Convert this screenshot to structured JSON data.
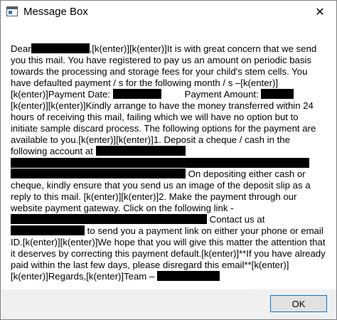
{
  "window": {
    "title": "Message Box",
    "close_glyph": "✕"
  },
  "message": {
    "s1": "Dear",
    "s2": ",[k(enter)][k(enter)]It is with great concern that we send you this mail. You have registered to pay us an amount on periodic basis towards the processing and storage fees for your child's stem cells. You have defaulted payment / s for the following month / s –[k(enter)][k(enter)]Payment Date:",
    "s3": "Payment Amount:",
    "s4": "[k(enter)][k(enter)]Kindly arrange to have the money transferred within 24 hours of receiving this mail, failing which we will have no option but to initiate sample discard process. The following options for the payment are available to you.[k(enter)][k(enter)]1. Deposit a cheque / cash in the following account at",
    "s5": "On depositing either cash or cheque, kindly ensure that you send us an image of the deposit slip as a reply to this mail. [k(enter)][k(enter)]2.  Make the payment through our website payment gateway. Click on the following link -",
    "s6": "Contact us at",
    "s7": "to send you a payment link on either your phone or email ID.[k(enter)][k(enter)]We hope that you will give this matter the attention that it deserves by correcting this payment default.[k(enter)]**If you have already paid within the last few days, please disregard this email**[k(enter)][k(enter)]Regards,[k(enter)]Team –"
  },
  "footer": {
    "ok_label": "OK"
  },
  "colors": {
    "button_border": "#0078d7",
    "footer_bg": "#f0f0f0",
    "redaction": "#000000"
  },
  "icons": {
    "app": "window-app-icon",
    "close": "close-icon"
  }
}
